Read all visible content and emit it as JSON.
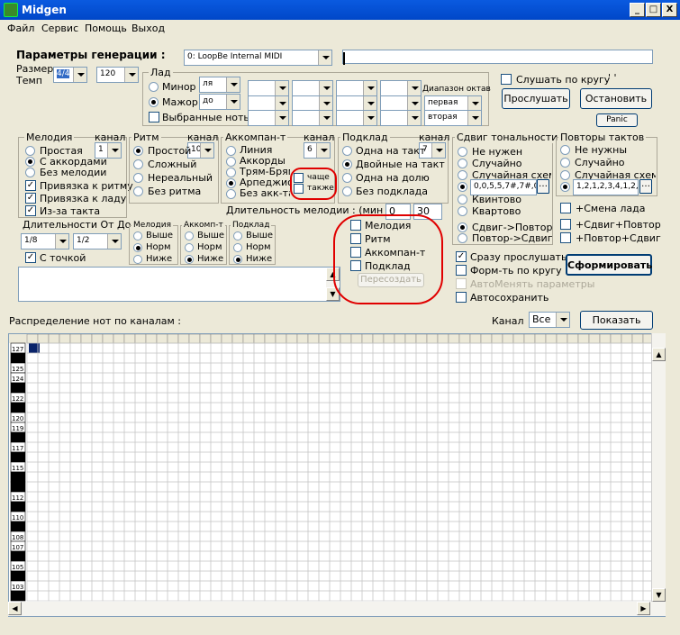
{
  "window": {
    "title": "Midgen",
    "min": "_",
    "max": "□",
    "close": "X"
  },
  "menu": [
    "Файл",
    "Сервис",
    "Помощь",
    "Выход"
  ],
  "params": {
    "label": "Параметры генерации :",
    "midi_port": "0: LoopBe Internal MIDI",
    "size_label": "Размер",
    "tempo_label": "Темп",
    "size_value": "4/4",
    "tempo_value": "120"
  },
  "lad": {
    "label": "Лад",
    "minor": "Минор",
    "major": "Мажор",
    "selected_notes": "Выбранные ноты",
    "minor_key": "ля",
    "major_key": "до",
    "octave_label": "Диапазон октав",
    "octave_first": "первая",
    "octave_second": "вторая"
  },
  "listen": {
    "loop": "Слушать по кругу",
    "dots": "' '",
    "listen_btn": "Прослушать",
    "stop_btn": "Остановить",
    "panic_btn": "Panic"
  },
  "melody": {
    "label": "Мелодия",
    "channel_label": "канал",
    "channel": "1",
    "simple": "Простая",
    "chords": "С аккордами",
    "none": "Без мелодии",
    "bind_rhythm": "Привязка к ритму",
    "bind_lad": "Привязка к ладу",
    "from_bar": "Из-за такта",
    "dur_label": "Длительности От До",
    "dur_from": "1/8",
    "dur_to": "1/2",
    "dotted": "С точкой"
  },
  "rhythm": {
    "label": "Ритм",
    "channel_label": "канал",
    "channel": "10",
    "simple": "Простой",
    "complex": "Сложный",
    "irregular": "Нереальный",
    "none": "Без ритма"
  },
  "accomp": {
    "label": "Аккомпан-т",
    "channel_label": "канал",
    "channel": "6",
    "line": "Линия",
    "chords": "Аккорды",
    "trem": "Трям-Брям",
    "arpeggio": "Арпеджио",
    "none": "Без акк-та",
    "more_often": "чаще",
    "also": "также"
  },
  "pad": {
    "label": "Подклад",
    "channel_label": "канал",
    "channel": "7",
    "one_per_bar": "Одна на такт",
    "two_per_bar": "Двойные на такт",
    "one_per_beat": "Одна на долю",
    "none": "Без подклада"
  },
  "melody_duration": {
    "label": "Длительность мелодии : (мин сек)",
    "min": "0",
    "sec": "30"
  },
  "pitch": {
    "melody": "Мелодия",
    "accomp": "Аккомп-т",
    "pad": "Подклад",
    "up": "Выше",
    "norm": "Норм",
    "down": "Ниже"
  },
  "recreate": {
    "melody": "Мелодия",
    "rhythm": "Ритм",
    "accomp": "Аккомпан-т",
    "pad": "Подклад",
    "button": "Пересоздать"
  },
  "shift": {
    "label": "Сдвиг тональности",
    "none": "Не нужен",
    "random": "Случайно",
    "random_scheme": "Случайная схема",
    "scheme": "0,0,5,5,7#,7#,0",
    "quint": "Квинтово",
    "quart": "Квартово",
    "shift_repeat": "Сдвиг->Повтор",
    "repeat_shift": "Повтор->Сдвиг"
  },
  "repeats": {
    "label": "Повторы тактов",
    "none": "Не нужны",
    "random": "Случайно",
    "random_scheme": "Случайная схема",
    "scheme": "1,2,1,2,3,4,1,2,1",
    "lad_change": "+Смена лада",
    "shift_repeat": "+Сдвиг+Повтор",
    "repeat_shift": "+Повтор+Сдвиг"
  },
  "opts": {
    "play_now": "Сразу прослушать",
    "loop_form": "Форм-ть по кругу",
    "auto_change": "АвтоМенять параметры",
    "autosave": "Автосохранить",
    "form_btn": "Сформировать"
  },
  "distribution": {
    "label": "Распределение нот по каналам :",
    "channel_label": "Канал",
    "channel_value": "Все",
    "show_btn": "Показать"
  },
  "grid": {
    "labels": [
      "127",
      "",
      "125",
      "124",
      "",
      "122",
      "",
      "120",
      "119",
      "",
      "117",
      "",
      "115",
      "",
      "",
      "112",
      "",
      "110",
      "",
      "108",
      "107",
      "",
      "105",
      "",
      "103"
    ]
  }
}
